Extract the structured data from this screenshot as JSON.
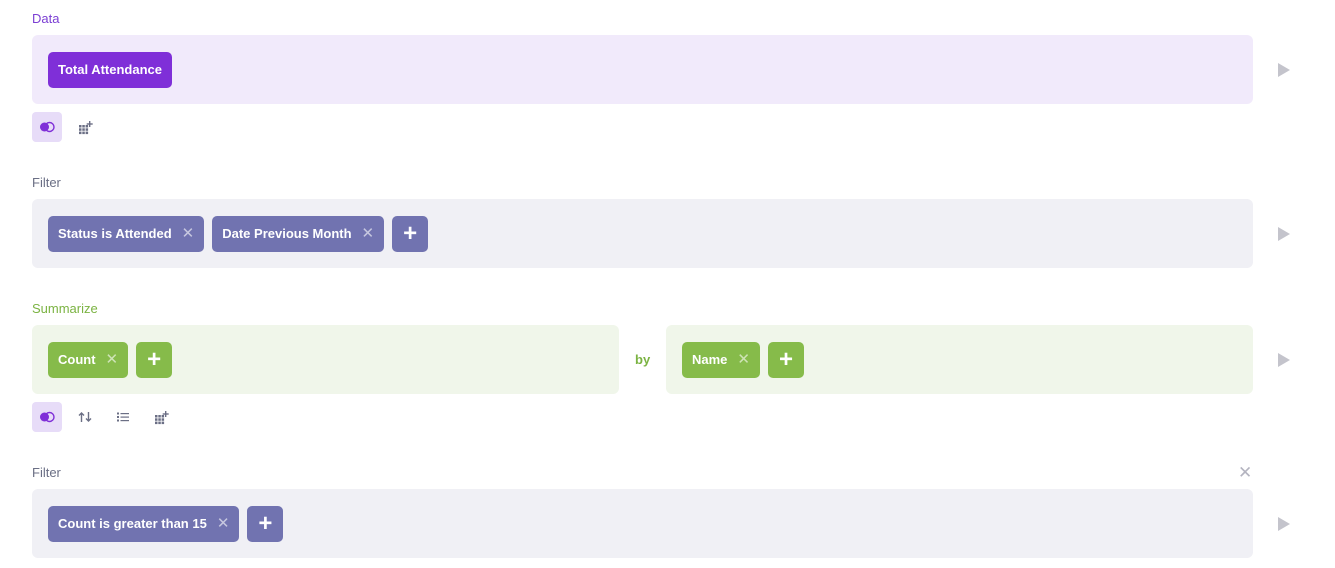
{
  "sections": {
    "data": {
      "label": "Data",
      "chip": "Total Attendance"
    },
    "filter1": {
      "label": "Filter",
      "chips": [
        "Status is Attended",
        "Date Previous Month"
      ]
    },
    "summarize": {
      "label": "Summarize",
      "metrics": [
        "Count"
      ],
      "by_label": "by",
      "groupings": [
        "Name"
      ]
    },
    "filter2": {
      "label": "Filter",
      "chips": [
        "Count is greater than 15"
      ]
    }
  },
  "icons": {
    "remove": "✕",
    "add": "+",
    "close": "✕"
  },
  "colors": {
    "data_accent": "#7f2fd8",
    "filter_accent": "#7173b0",
    "summarize_accent": "#86bb4a"
  }
}
